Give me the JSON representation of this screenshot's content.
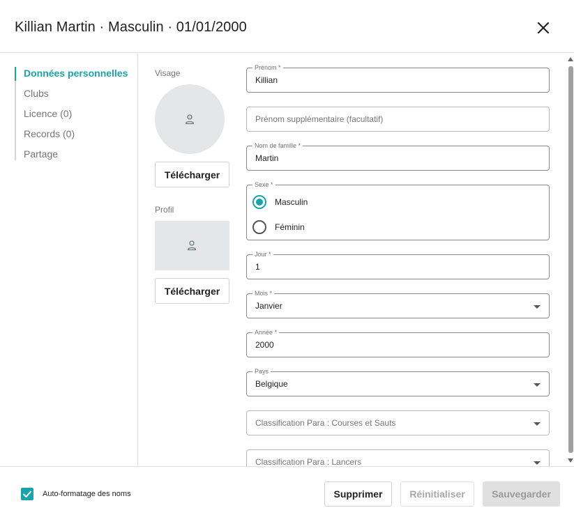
{
  "header": {
    "title": "Killian Martin · Masculin · 01/01/2000"
  },
  "nav": {
    "items": [
      {
        "label": "Données personnelles"
      },
      {
        "label": "Clubs"
      },
      {
        "label": "Licence (0)"
      },
      {
        "label": "Records (0)"
      },
      {
        "label": "Partage"
      }
    ]
  },
  "photos": {
    "face_label": "Visage",
    "profile_label": "Profil",
    "upload_label": "Télécharger"
  },
  "form": {
    "first_name": {
      "label": "Prénom *",
      "value": "Killian"
    },
    "extra_first_name": {
      "placeholder": "Prénom supplémentaire (facultatif)"
    },
    "last_name": {
      "label": "Nom de famille *",
      "value": "Martin"
    },
    "sex": {
      "label": "Sexe *",
      "options": [
        {
          "label": "Masculin",
          "selected": true
        },
        {
          "label": "Féminin",
          "selected": false
        }
      ]
    },
    "day": {
      "label": "Jour *",
      "value": "1"
    },
    "month": {
      "label": "Mois *",
      "value": "Janvier"
    },
    "year": {
      "label": "Année *",
      "value": "2000"
    },
    "country": {
      "label": "Pays",
      "value": "Belgique"
    },
    "para_running": {
      "placeholder": "Classification Para : Courses et Sauts"
    },
    "para_throws": {
      "placeholder": "Classification Para : Lancers"
    }
  },
  "footer": {
    "autoformat_label": "Auto-formatage des noms",
    "autoformat_checked": true,
    "delete_label": "Supprimer",
    "reset_label": "Réinitialiser",
    "save_label": "Sauvegarder"
  },
  "colors": {
    "accent": "#1aa3a8"
  }
}
